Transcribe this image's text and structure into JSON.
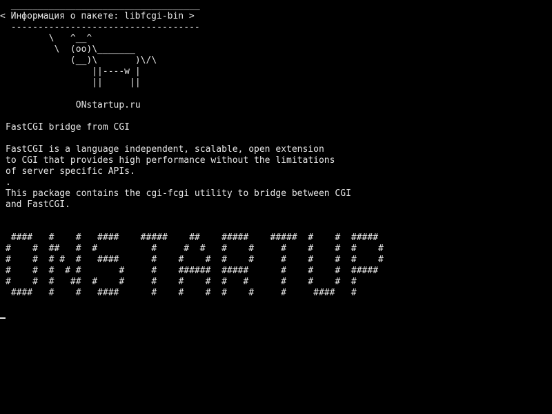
{
  "cowsay": {
    "border_top": " ___________________________________",
    "message": "< Информация о пакете: libfcgi-bin >",
    "border_bottom": " -----------------------------------",
    "cow": [
      "        \\   ^__^",
      "         \\  (oo)\\_______",
      "            (__)\\       )\\/\\",
      "                ||----w |",
      "                ||     ||"
    ],
    "site": "             ONstartup.ru"
  },
  "package": {
    "summary": "FastCGI bridge from CGI",
    "description": [
      "FastCGI is a language independent, scalable, open extension",
      "to CGI that provides high performance without the limitations",
      "of server specific APIs.",
      ".",
      "This package contains the cgi-fcgi utility to bridge between CGI",
      "and FastCGI."
    ]
  },
  "banner": [
    " ####   #    #   ####    #####    ##    #####    #####  #    #  #####",
    "#    #  ##   #  #          #     #  #   #    #     #    #    #  #    #",
    "#    #  # #  #   ####      #    #    #  #    #     #    #    #  #    #",
    "#    #  #  # #       #     #    ######  #####      #    #    #  #####",
    "#    #  #   ##  #    #     #    #    #  #   #      #    #    #  #",
    " ####   #    #   ####      #    #    #  #    #     #     ####   #"
  ]
}
